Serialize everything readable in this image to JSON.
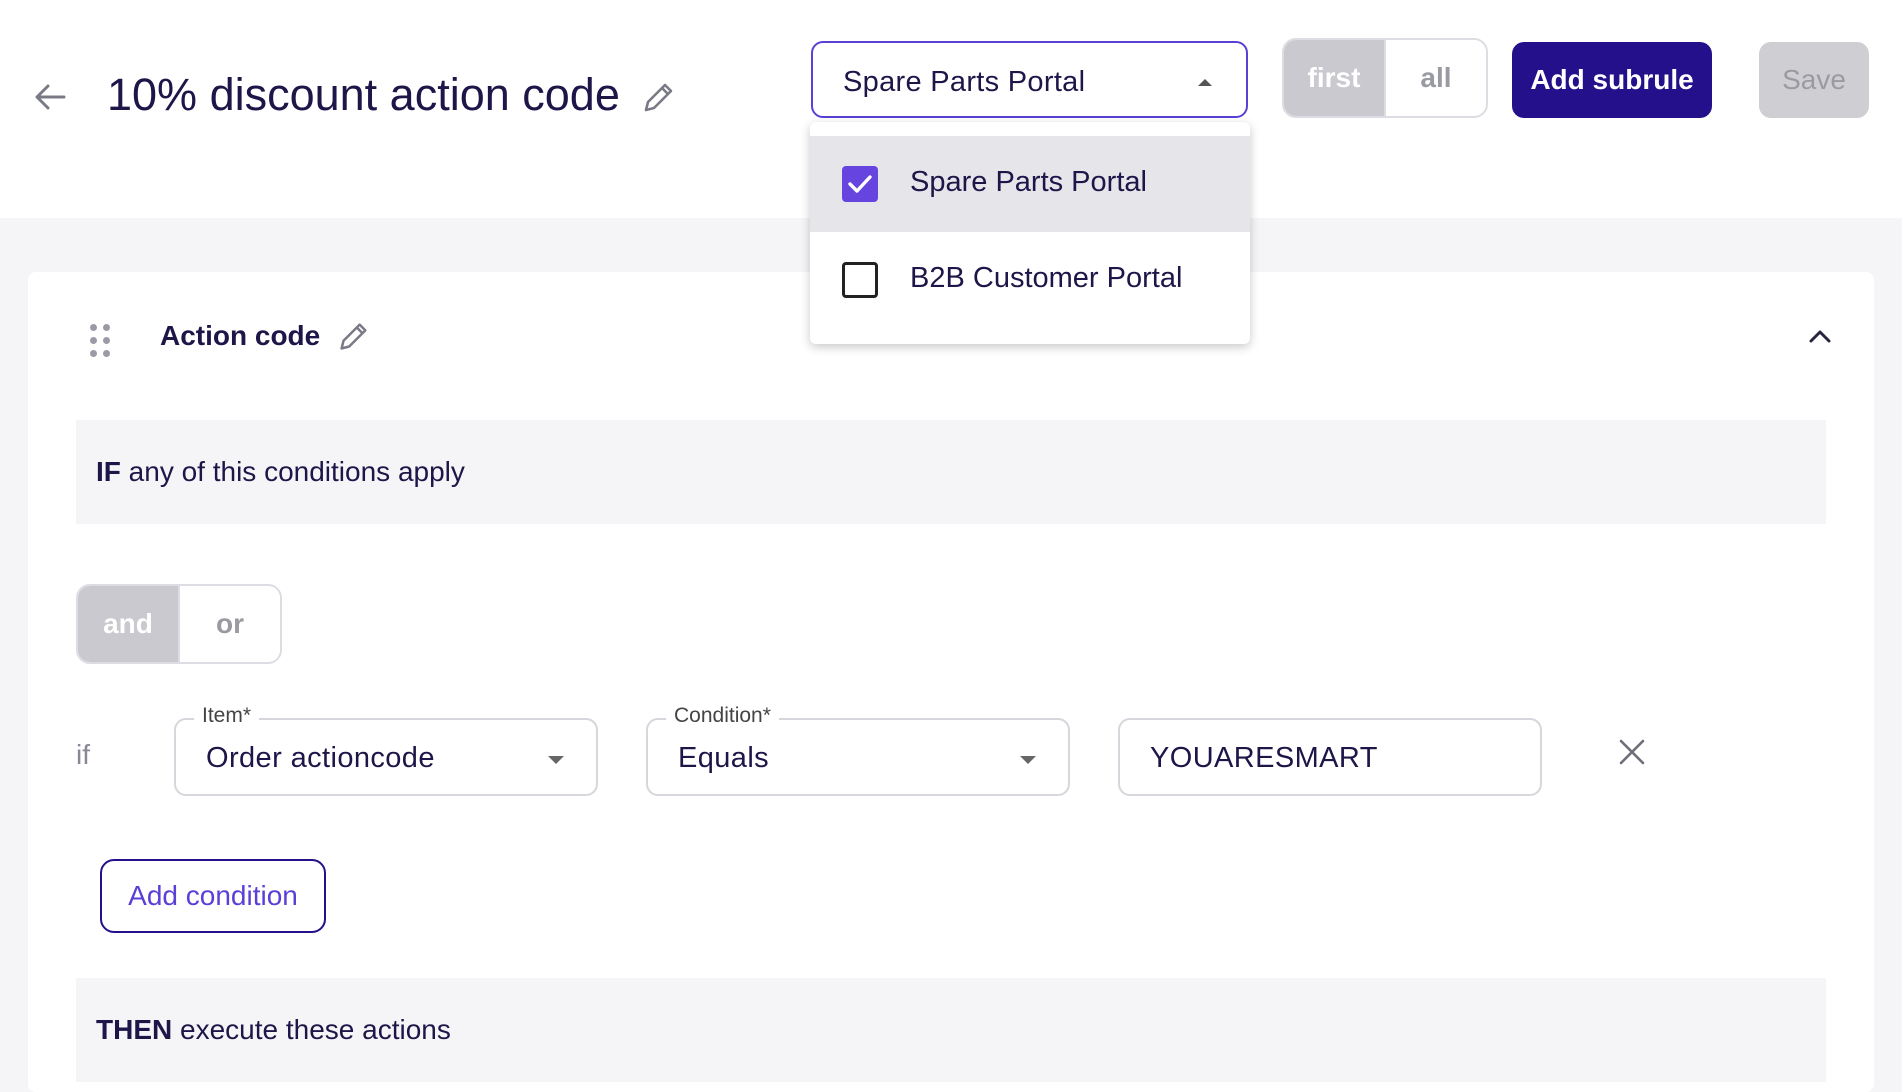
{
  "header": {
    "title": "10% discount action code",
    "portal_select": {
      "value": "Spare Parts Portal"
    },
    "mode_toggle": {
      "options": [
        "first",
        "all"
      ],
      "active": "first"
    },
    "add_subrule_label": "Add subrule",
    "save_label": "Save"
  },
  "portal_menu": {
    "items": [
      {
        "label": "Spare Parts Portal",
        "checked": true
      },
      {
        "label": "B2B Customer Portal",
        "checked": false
      }
    ]
  },
  "rule": {
    "title": "Action code",
    "if_banner": {
      "keyword": "IF",
      "text": " any of this conditions apply"
    },
    "logic_toggle": {
      "options": [
        "and",
        "or"
      ],
      "active": "and"
    },
    "if_label": "if",
    "condition_row": {
      "item_legend": "Item*",
      "item_value": "Order actioncode",
      "condition_legend": "Condition*",
      "condition_value": "Equals",
      "value": "YOUARESMART"
    },
    "add_condition_label": "Add condition",
    "then_banner": {
      "keyword": "THEN",
      "text": " execute these actions"
    }
  },
  "colors": {
    "primary": "#24108a",
    "accent": "#5b3fd6",
    "checkbox": "#6544e0",
    "disabled": "#cfcfd3",
    "page_bg": "#f5f5f7"
  },
  "icons": [
    "arrow-left-icon",
    "pencil-icon",
    "caret-up-icon",
    "caret-down-icon",
    "check-icon",
    "drag-handle-icon",
    "chevron-up-icon",
    "close-icon"
  ]
}
